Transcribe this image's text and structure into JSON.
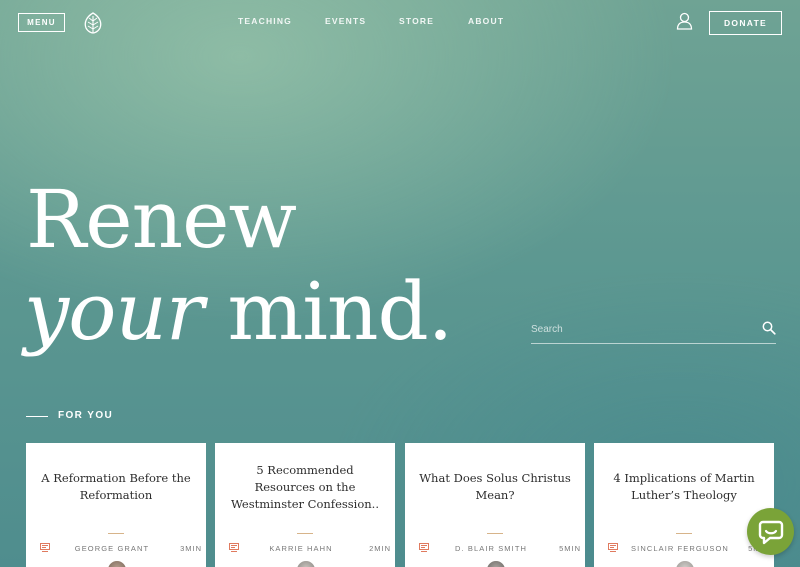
{
  "header": {
    "menu_label": "MENU",
    "nav": [
      "TEACHING",
      "EVENTS",
      "STORE",
      "ABOUT"
    ],
    "donate_label": "DONATE"
  },
  "hero": {
    "line1": "Renew",
    "line2_italic": "your",
    "line2_rest": " mind."
  },
  "search": {
    "placeholder": "Search"
  },
  "section": {
    "label": "FOR YOU"
  },
  "cards": [
    {
      "title": "A Reformation Before the Reformation",
      "author": "GEORGE GRANT",
      "time": "3MIN"
    },
    {
      "title": "5 Recommended Resources on the Westminster Confession..",
      "author": "KARRIE HAHN",
      "time": "2MIN"
    },
    {
      "title": "What Does Solus Christus Mean?",
      "author": "D. BLAIR SMITH",
      "time": "5MIN"
    },
    {
      "title": "4 Implications of Martin Luther’s Theology",
      "author": "SINCLAIR FERGUSON",
      "time": "5MIN"
    }
  ],
  "colors": {
    "accent_divider": "#d7b48a",
    "article_icon": "#e07a5f",
    "chat_button": "#7aa338"
  },
  "icons": {
    "logo": "leaf-logo-icon",
    "user": "user-icon",
    "search": "search-icon",
    "article": "article-icon",
    "chat": "chat-bubble-icon"
  }
}
